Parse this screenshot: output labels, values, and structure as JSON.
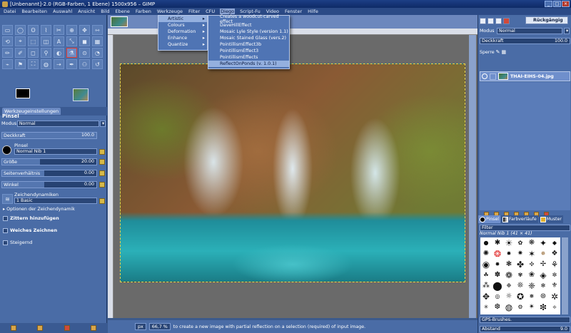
{
  "window": {
    "title": "[Unbenannt]-2.0 (RGB-Farben, 1 Ebene) 1500x956 – GIMP"
  },
  "menubar": [
    "Datei",
    "Bearbeiten",
    "Auswahl",
    "Ansicht",
    "Bild",
    "Ebene",
    "Farben",
    "Werkzeuge",
    "Filter",
    "CFU",
    "Diego",
    "Script-Fu",
    "Video",
    "Fenster",
    "Hilfe"
  ],
  "menu_active": "Diego",
  "diego_menu": {
    "items": [
      "Artistic",
      "Colours",
      "Deformation",
      "Enhance",
      "Quantize"
    ],
    "active": "Artistic"
  },
  "artistic_submenu": {
    "items": [
      "Creates a woodcut-carved effect",
      "DaveHillEffect",
      "Mosaic Lyle Style (version 1.1)",
      "Mosaic Stained Glass (vers.2)",
      "PointillismEffect3b",
      "PointillismEffect3",
      "PointillismEffects",
      "ReflectOnPonds (v. 1.0.1)"
    ],
    "active": "ReflectOnPonds (v. 1.0.1)"
  },
  "left_panel": {
    "tab_label": "Werkzeugeinstellungen",
    "tool_title": "Pinsel",
    "modus_label": "Modus",
    "modus_value": "Normal",
    "deckkraft": {
      "label": "Deckkraft",
      "value": "100.0",
      "fraction": 1.0
    },
    "pinsel_label": "Pinsel",
    "pinsel_value": "Normal Nib 1",
    "groesse": {
      "label": "Größe",
      "value": "20.00",
      "fraction": 0.4
    },
    "seitenverhaeltnis": {
      "label": "Seitenverhältnis",
      "value": "0.00",
      "fraction": 0.45
    },
    "winkel": {
      "label": "Winkel",
      "value": "0.00",
      "fraction": 0.45
    },
    "dynamik_label": "Zeichendynamiken",
    "dynamik_value": "1 Basic",
    "dynamik_options": "Optionen der Zeichendynamik",
    "zittern": "Zittern hinzufügen",
    "weiches": "Weiches Zeichnen",
    "steigernd": "Steigernd"
  },
  "tools": [
    "▭",
    "◯",
    "ʘ",
    "⌇",
    "✂",
    "⊕",
    "✥",
    "⇿",
    "⟲",
    "⌖",
    "⬚",
    "◫",
    "A",
    "⤡",
    "◼",
    "▦",
    "✏",
    "✐",
    "◻",
    "⚲",
    "◐",
    "⚗",
    "⊙",
    "◔",
    "⌁",
    "⚑",
    "⛶",
    "◍",
    "⇢",
    "✒",
    "⚇",
    "↺"
  ],
  "tool_selected_index": 21,
  "statusbar": {
    "unit": "px",
    "zoom": "66,7 %",
    "message": "to create a new image with partial reflection on a selection (required) of input image."
  },
  "right_panel": {
    "undo_label": "Rückgängig",
    "modus_label": "Modus",
    "modus_value": "Normal",
    "deckkraft_label": "Deckkraft",
    "deckkraft_value": "100.0",
    "sperre_label": "Sperre",
    "layer_name": "THAI-EIHS-04.jpg",
    "tabs": [
      "Pinsel",
      "Farbverläufe",
      "Muster"
    ],
    "filter_placeholder": "Filter",
    "brush_name": "Normal Nib 1 (41 × 41)",
    "tag_value": "GPS-Brushes.",
    "abstand_label": "Abstand",
    "abstand_value": "9.0"
  }
}
